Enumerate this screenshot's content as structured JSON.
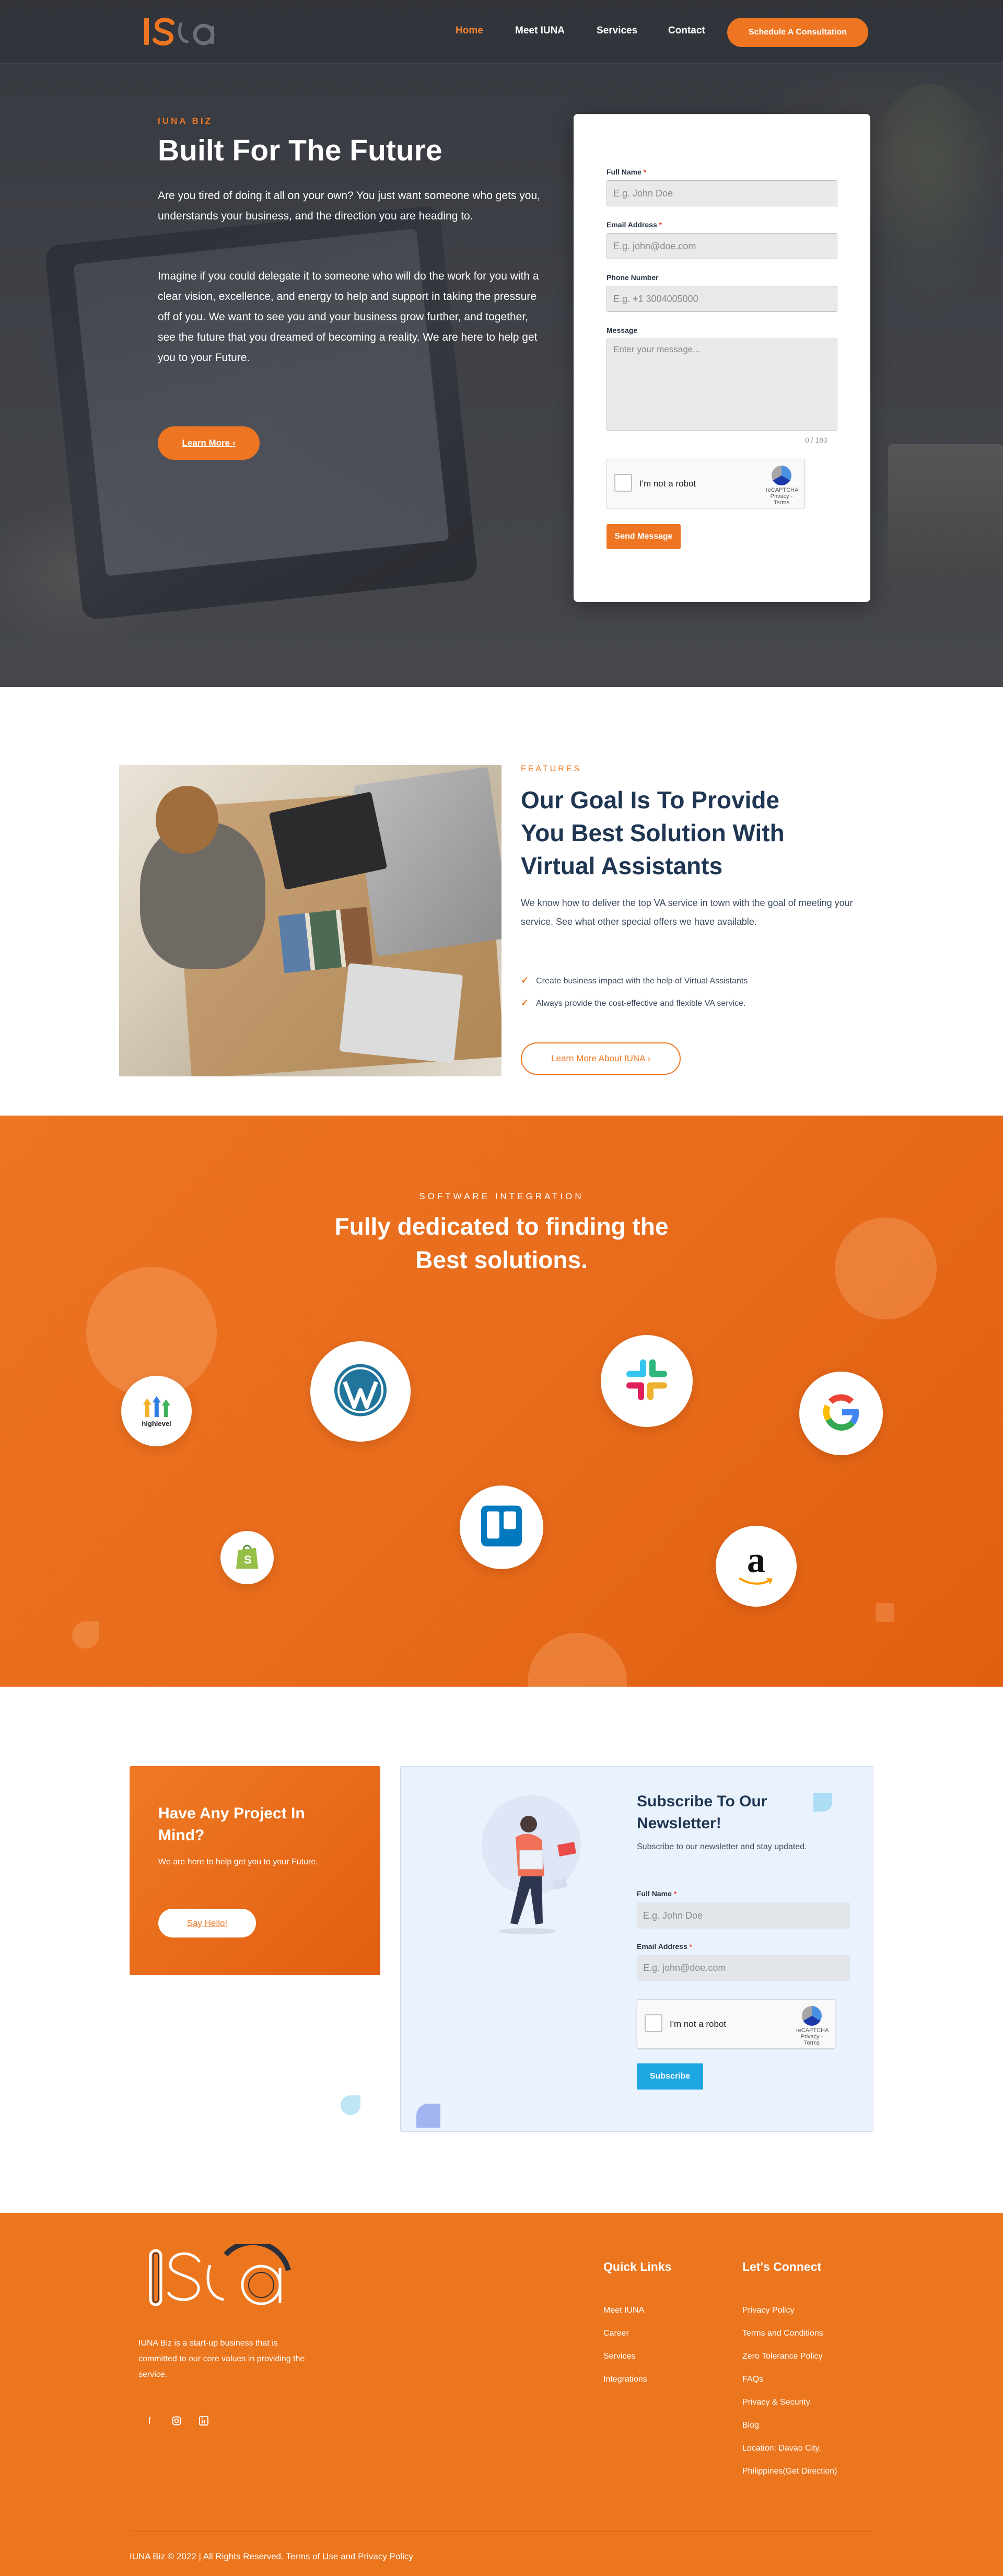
{
  "nav": {
    "logo_text": "IUNA",
    "links": [
      "Home",
      "Meet IUNA",
      "Services",
      "Contact"
    ],
    "cta": "Schedule A Consultation"
  },
  "hero": {
    "eyebrow": "IUNA BIZ",
    "title": "Built For The Future",
    "p1": "Are you tired of doing it all on your own? You just want someone who gets you, understands your business, and the direction you are heading to.",
    "p2": "Imagine if you could delegate it to someone who will do the work for you with a clear vision, excellence, and energy to help and support in taking the pressure off of you. We want to see you and your business grow further, and together, see the future that you dreamed of becoming a reality. We are here to help get you to your Future.",
    "button": "Learn More ›"
  },
  "contact_form": {
    "full_name_label": "Full Name",
    "full_name_placeholder": "E.g. John Doe",
    "email_label": "Email Address",
    "email_placeholder": "E.g. john@doe.com",
    "phone_label": "Phone Number",
    "phone_placeholder": "E.g. +1 3004005000",
    "message_label": "Message",
    "message_placeholder": "Enter your message...",
    "char_count": "0 / 180",
    "captcha_text": "I'm not a robot",
    "captcha_brand": "reCAPTCHA",
    "captcha_links": "Privacy - Terms",
    "submit": "Send Message",
    "required_mark": "*"
  },
  "features": {
    "eyebrow": "FEATURES",
    "title": "Our Goal Is To Provide You Best Solution With Virtual Assistants",
    "description": "We know how to deliver the top VA service in town with the goal of meeting your service. See what other special offers we have available.",
    "items": [
      "Create business impact with the help of Virtual Assistants",
      "Always provide the cost-effective and flexible VA service."
    ],
    "button": "Learn More About IUNA ›"
  },
  "software": {
    "eyebrow": "SOFTWARE INTEGRATION",
    "title": "Fully dedicated to finding the Best solutions.",
    "highlevel_label": "highlevel"
  },
  "project": {
    "title": "Have Any Project In Mind?",
    "subtitle": "We are here to help get you to your Future.",
    "button": "Say Hello!"
  },
  "newsletter": {
    "title": "Subscribe To Our Newsletter!",
    "subtitle": "Subscribe to our newsletter and stay updated.",
    "full_name_label": "Full Name",
    "full_name_placeholder": "E.g. John Doe",
    "email_label": "Email Address",
    "email_placeholder": "E.g. john@doe.com",
    "captcha_text": "I'm not a robot",
    "captcha_brand": "reCAPTCHA",
    "captcha_links": "Privacy - Terms",
    "button": "Subscribe",
    "required_mark": "*"
  },
  "footer": {
    "description": "IUNA Biz is a start-up business that is committed to our core values in providing the service.",
    "quick_links_heading": "Quick Links",
    "quick_links": [
      "Meet IUNA",
      "Career",
      "Services",
      "Integrations"
    ],
    "connect_heading": "Let's Connect",
    "connect_links": [
      "Privacy Policy",
      "Terms and Conditions",
      "Zero Tolerance Policy",
      "FAQs",
      "Privacy & Security",
      "Blog",
      "Location: Davao City,",
      "Philippines(Get Direction)"
    ],
    "social_icons": [
      "facebook-icon",
      "instagram-icon",
      "linkedin-icon"
    ],
    "copyright": "IUNA Biz © 2022 | All Rights Reserved. Terms of Use and Privacy Policy"
  },
  "colors": {
    "brand_orange": "#ee7623",
    "navy": "#1f3653",
    "subscribe_blue": "#1ea6e3"
  }
}
